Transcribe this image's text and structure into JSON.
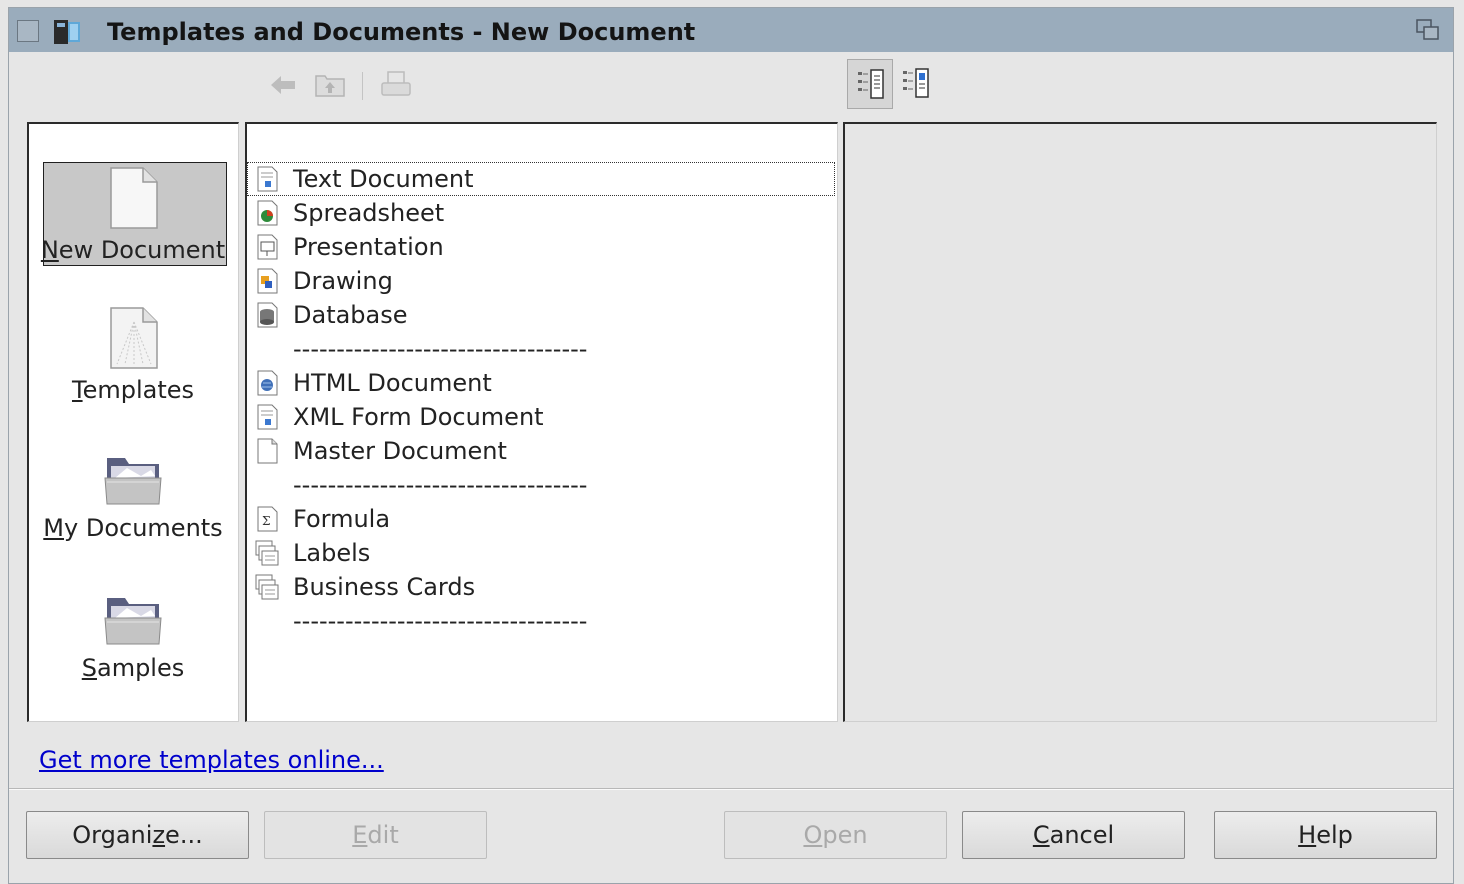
{
  "window": {
    "title": "Templates and Documents - New Document",
    "icons": {
      "menu": "window-menu-icon",
      "app": "office-app-icon",
      "restore": "restore-window-icon"
    }
  },
  "toolbar": {
    "back": {
      "icon": "back-arrow-icon",
      "enabled": false
    },
    "up": {
      "icon": "folder-up-icon",
      "enabled": false
    },
    "print": {
      "icon": "print-icon",
      "enabled": false
    },
    "view_document": {
      "icon": "document-preview-icon",
      "active": true
    },
    "view_properties": {
      "icon": "document-properties-icon",
      "active": false
    }
  },
  "categories": [
    {
      "label": "New Document",
      "selected": true,
      "icon": "blank-page-icon",
      "mnemonic": "N"
    },
    {
      "label": "Templates",
      "selected": false,
      "icon": "templates-icon",
      "mnemonic": "T"
    },
    {
      "label": "My Documents",
      "selected": false,
      "icon": "folder-icon",
      "mnemonic": "M"
    },
    {
      "label": "Samples",
      "selected": false,
      "icon": "folder-icon",
      "mnemonic": "S"
    }
  ],
  "documents": [
    {
      "label": "Text Document",
      "icon": "text-document-icon",
      "focused": true
    },
    {
      "label": "Spreadsheet",
      "icon": "spreadsheet-icon"
    },
    {
      "label": "Presentation",
      "icon": "presentation-icon"
    },
    {
      "label": "Drawing",
      "icon": "drawing-icon"
    },
    {
      "label": "Database",
      "icon": "database-icon"
    },
    {
      "label": "----------------------------------",
      "separator": true
    },
    {
      "label": "HTML Document",
      "icon": "html-document-icon"
    },
    {
      "label": "XML Form Document",
      "icon": "xml-form-icon"
    },
    {
      "label": "Master Document",
      "icon": "master-document-icon"
    },
    {
      "label": "----------------------------------",
      "separator": true
    },
    {
      "label": "Formula",
      "icon": "formula-icon"
    },
    {
      "label": "Labels",
      "icon": "labels-icon"
    },
    {
      "label": "Business Cards",
      "icon": "business-cards-icon"
    },
    {
      "label": "----------------------------------",
      "separator": true
    }
  ],
  "online_link": "Get more templates online...",
  "buttons": {
    "organize": {
      "pre": "Organi",
      "key": "z",
      "post": "e...",
      "enabled": true
    },
    "edit": {
      "pre": "",
      "key": "E",
      "post": "dit",
      "enabled": false
    },
    "open": {
      "pre": "",
      "key": "O",
      "post": "pen",
      "enabled": false
    },
    "cancel": {
      "pre": "",
      "key": "C",
      "post": "ancel",
      "enabled": true
    },
    "help": {
      "pre": "",
      "key": "H",
      "post": "elp",
      "enabled": true
    }
  },
  "colors": {
    "titlebar": "#9aacbc",
    "link": "#0000cc",
    "selection": "#c8c8c8"
  }
}
